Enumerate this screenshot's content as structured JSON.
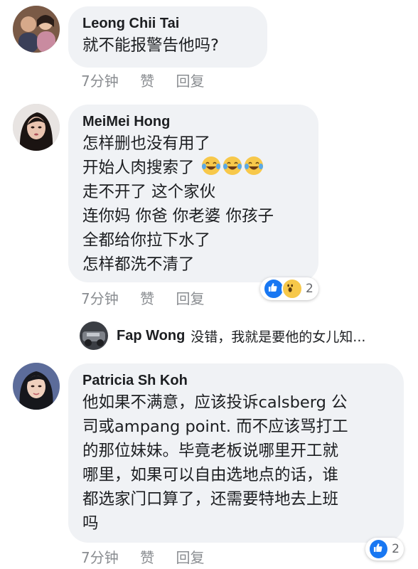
{
  "comments": [
    {
      "name": "Leong Chii Tai",
      "lines": [
        "就不能报警告他吗?"
      ],
      "time": "7分钟",
      "like": "赞",
      "reply": "回复"
    },
    {
      "name": "MeiMei Hong",
      "lines": [
        "怎样删也没有用了",
        "开始人肉搜索了",
        "走不开了 这个家伙",
        "连你妈 你爸 你老婆 你孩子",
        "全都给你拉下水了",
        "怎样都洗不清了"
      ],
      "emoji": [
        "laughing-tears-emoji",
        "laughing-tears-emoji",
        "laughing-tears-emoji"
      ],
      "time": "7分钟",
      "like": "赞",
      "reply": "回复",
      "reactions": {
        "icons": [
          "like-icon",
          "wow-icon"
        ],
        "count": "2"
      }
    },
    {
      "name": "Patricia Sh Koh",
      "lines": [
        "他如果不满意，应该投诉calsberg 公",
        "司或ampang point. 而不应该骂打工",
        "的那位妹妹。毕竟老板说哪里开工就",
        "哪里，如果可以自由选地点的话，谁",
        "都选家门口算了，还需要特地去上班",
        "吗"
      ],
      "time": "7分钟",
      "like": "赞",
      "reply": "回复",
      "reactions": {
        "icons": [
          "like-icon"
        ],
        "count": "2"
      }
    }
  ],
  "reply_preview": {
    "name": "Fap Wong",
    "text": "没错，我就是要他的女儿知..."
  },
  "colors": {
    "bubble": "#f0f2f5",
    "meta": "#8a8d91",
    "like_blue": "#1877f2",
    "wow_yellow": "#f7c84a"
  }
}
